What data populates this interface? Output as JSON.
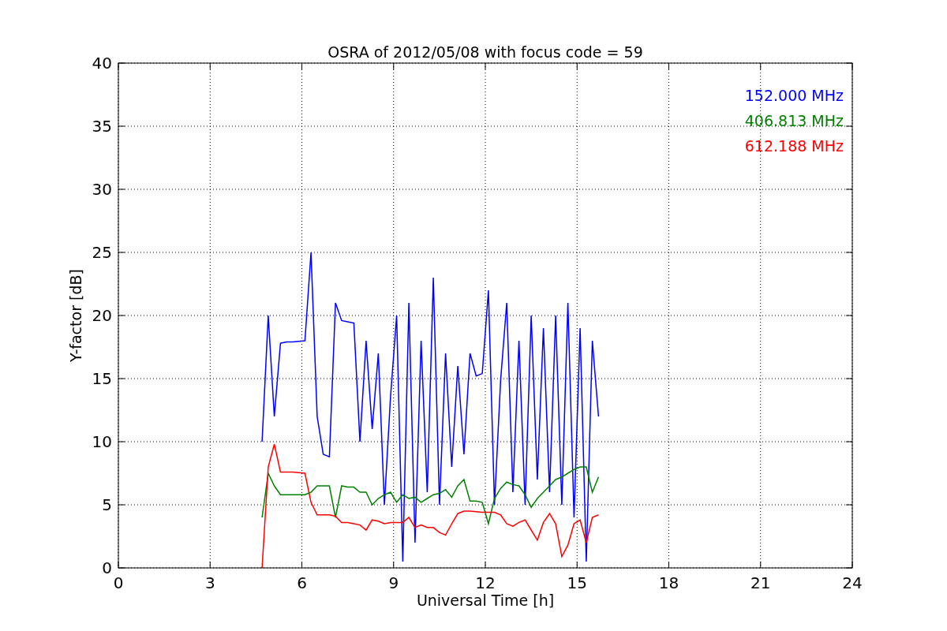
{
  "figure": {
    "chart_data": {
      "type": "line",
      "title": "OSRA of 2012/05/08 with focus code = 59",
      "xlabel": "Universal Time [h]",
      "ylabel": "Y-factor [dB]",
      "xlim": [
        0,
        24
      ],
      "ylim": [
        0,
        40
      ],
      "xticks": [
        0,
        3,
        6,
        9,
        12,
        15,
        18,
        21,
        24
      ],
      "yticks": [
        0,
        5,
        10,
        15,
        20,
        25,
        30,
        35,
        40
      ],
      "grid": true,
      "x": [
        4.7,
        4.9,
        5.1,
        5.3,
        5.5,
        5.7,
        5.9,
        6.1,
        6.3,
        6.5,
        6.7,
        6.9,
        7.1,
        7.3,
        7.5,
        7.7,
        7.9,
        8.1,
        8.3,
        8.5,
        8.7,
        8.9,
        9.1,
        9.3,
        9.5,
        9.7,
        9.9,
        10.1,
        10.3,
        10.5,
        10.7,
        10.9,
        11.1,
        11.3,
        11.5,
        11.7,
        11.9,
        12.1,
        12.3,
        12.5,
        12.7,
        12.9,
        13.1,
        13.3,
        13.5,
        13.7,
        13.9,
        14.1,
        14.3,
        14.5,
        14.7,
        14.9,
        15.1,
        15.3,
        15.5,
        15.7
      ],
      "series": [
        {
          "name": "152.000 MHz",
          "color": "#0000ff",
          "values": [
            10,
            20,
            12,
            17.8,
            17.9,
            17.9,
            17.95,
            18,
            25,
            12,
            9,
            8.8,
            21,
            19.6,
            19.5,
            19.4,
            10,
            18,
            11,
            17,
            5,
            13.6,
            20,
            0.5,
            21,
            2,
            18,
            6,
            23,
            5,
            17,
            8,
            16,
            9,
            17,
            15.2,
            15.4,
            22,
            5,
            14.9,
            21,
            6,
            18,
            5,
            20,
            7,
            19,
            6,
            20,
            5,
            21,
            4,
            19,
            0.5,
            18,
            12
          ]
        },
        {
          "name": "406.813 MHz",
          "color": "#008000",
          "values": [
            4,
            7.5,
            6.5,
            5.8,
            5.8,
            5.8,
            5.8,
            5.8,
            6,
            6.5,
            6.5,
            6.5,
            4,
            6.5,
            6.4,
            6.4,
            6,
            6,
            5,
            5.5,
            5.8,
            6,
            5.2,
            5.8,
            5.5,
            5.6,
            5.2,
            5.5,
            5.8,
            5.9,
            6.2,
            5.6,
            6.5,
            7,
            5.3,
            5.3,
            5.2,
            3.5,
            5.5,
            6.3,
            6.8,
            6.6,
            6.5,
            5.8,
            4.8,
            5.5,
            6,
            6.5,
            7,
            7.2,
            7.5,
            7.8,
            8,
            8,
            6,
            7.2
          ]
        },
        {
          "name": "612.188 MHz",
          "color": "#ff0000",
          "values": [
            0,
            8,
            9.8,
            7.6,
            7.6,
            7.6,
            7.55,
            7.5,
            5.2,
            4.2,
            4.2,
            4.2,
            4.1,
            3.6,
            3.6,
            3.5,
            3.4,
            3,
            3.8,
            3.7,
            3.5,
            3.6,
            3.6,
            3.6,
            4,
            3.2,
            3.4,
            3.2,
            3.2,
            2.8,
            2.6,
            3.5,
            4.3,
            4.5,
            4.5,
            4.45,
            4.4,
            4.4,
            4.4,
            4.2,
            3.5,
            3.3,
            3.6,
            3.8,
            3,
            2.2,
            3.6,
            4.3,
            3.5,
            0.9,
            1.8,
            3.5,
            3.8,
            2,
            4,
            4.2
          ]
        }
      ]
    }
  }
}
